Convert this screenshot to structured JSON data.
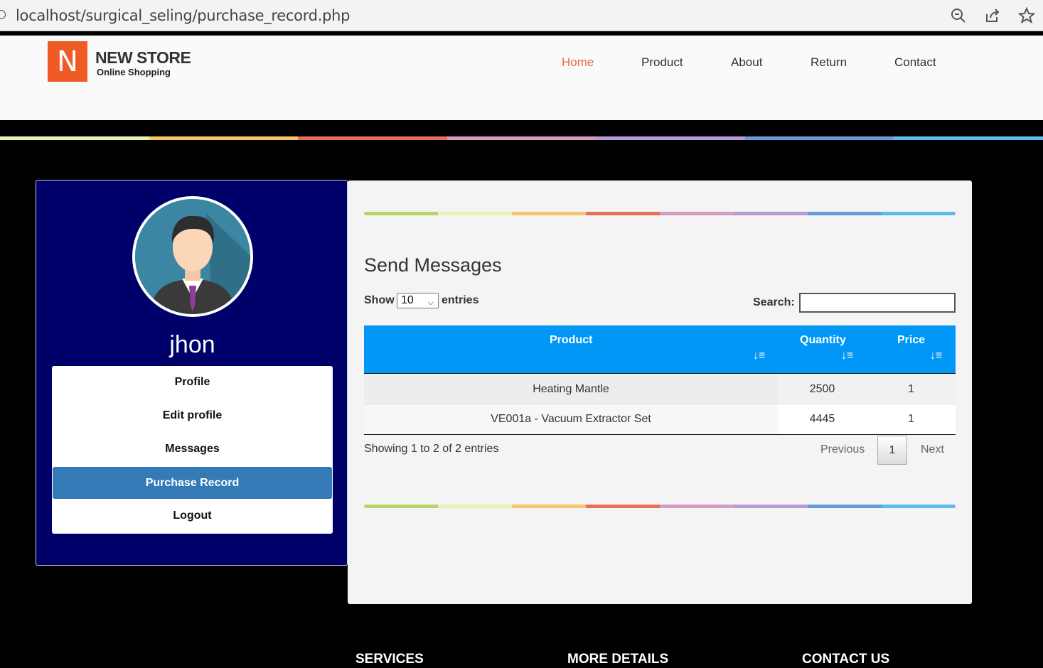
{
  "browser": {
    "url": "localhost/surgical_seling/purchase_record.php"
  },
  "header": {
    "logo_letter": "N",
    "logo_title": "NEW STORE",
    "logo_subtitle": "Online Shopping",
    "nav": [
      {
        "label": "Home",
        "active": true
      },
      {
        "label": "Product"
      },
      {
        "label": "About"
      },
      {
        "label": "Return"
      },
      {
        "label": "Contact"
      }
    ]
  },
  "sidebar": {
    "username": "jhon",
    "menu": [
      {
        "label": "Profile"
      },
      {
        "label": "Edit profile"
      },
      {
        "label": "Messages"
      },
      {
        "label": "Purchase Record",
        "active": true
      },
      {
        "label": "Logout"
      }
    ]
  },
  "main": {
    "title": "Send Messages",
    "show_label": "Show",
    "page_length": "10",
    "entries_label": "entries",
    "search_label": "Search:",
    "search_value": "",
    "columns": [
      "Product",
      "Quantity",
      "Price"
    ],
    "rows": [
      {
        "product": "Heating Mantle",
        "quantity": "2500",
        "price": "1"
      },
      {
        "product": "VE001a - Vacuum Extractor Set",
        "quantity": "4445",
        "price": "1"
      }
    ],
    "info": "Showing 1 to 2 of 2 entries",
    "pagination": {
      "previous": "Previous",
      "current": "1",
      "next": "Next"
    }
  },
  "footer": {
    "headings": [
      "SERVICES",
      "MORE DETAILS",
      "CONTACT US"
    ]
  },
  "colors": {
    "accent_orange": "#f05a24",
    "sidebar_bg": "#00006b",
    "table_header": "#0097f7",
    "active_menu": "#337ab7",
    "rainbow": [
      "#b5d56a",
      "#eef1b6",
      "#f7c56a",
      "#e86e5e",
      "#d79ac1",
      "#b79ad8",
      "#6a9ad8",
      "#5bbde8"
    ]
  }
}
